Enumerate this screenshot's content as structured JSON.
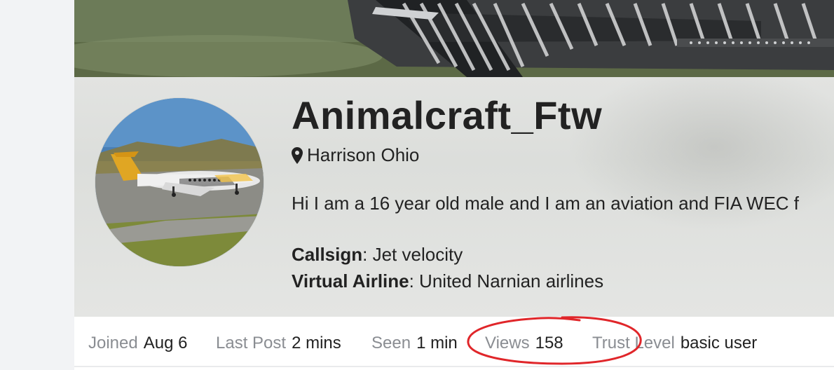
{
  "profile": {
    "username": "Animalcraft_Ftw",
    "location": "Harrison Ohio",
    "bio": "Hi I am a 16 year old male and I am an aviation and FIA WEC f",
    "fields": [
      {
        "label": "Callsign",
        "value": ": Jet velocity"
      },
      {
        "label": "Virtual Airline",
        "value": ": United Narnian airlines"
      }
    ]
  },
  "stats": [
    {
      "label": "Joined",
      "value": "Aug 6"
    },
    {
      "label": "Last Post",
      "value": "2 mins"
    },
    {
      "label": "Seen",
      "value": "1 min"
    },
    {
      "label": "Views",
      "value": "158"
    },
    {
      "label": "Trust Level",
      "value": "basic user"
    }
  ],
  "icons": {
    "location": "map-marker-icon"
  },
  "colors": {
    "annotation": "#e0262a",
    "stat_label": "#8a8d92",
    "text": "#222222"
  }
}
